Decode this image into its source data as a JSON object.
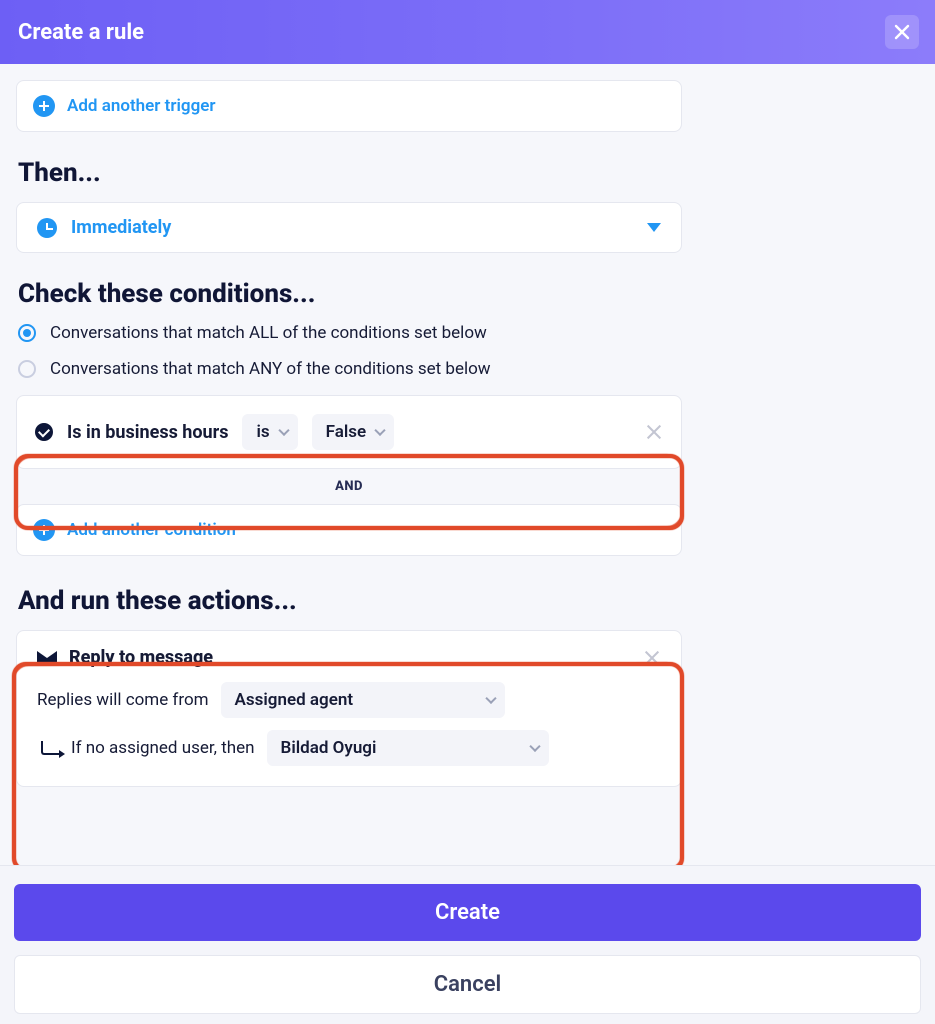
{
  "header": {
    "title": "Create a rule"
  },
  "trigger_section": {
    "add_label": "Add another trigger"
  },
  "then_section": {
    "heading": "Then...",
    "option_label": "Immediately"
  },
  "conditions_section": {
    "heading": "Check these conditions...",
    "radio_all": "Conversations that match ALL of the conditions set below",
    "radio_any": "Conversations that match ANY of the conditions set below",
    "selected_mode": "all",
    "condition": {
      "field": "Is in business hours",
      "operator": "is",
      "value": "False"
    },
    "separator": "AND",
    "add_label": "Add another condition"
  },
  "actions_section": {
    "heading": "And run these actions...",
    "action_title": "Reply to message",
    "from_label": "Replies will come from",
    "from_value": "Assigned agent",
    "fallback_label": "If no assigned user, then",
    "fallback_value": "Bildad Oyugi"
  },
  "footer": {
    "primary": "Create",
    "secondary": "Cancel"
  }
}
